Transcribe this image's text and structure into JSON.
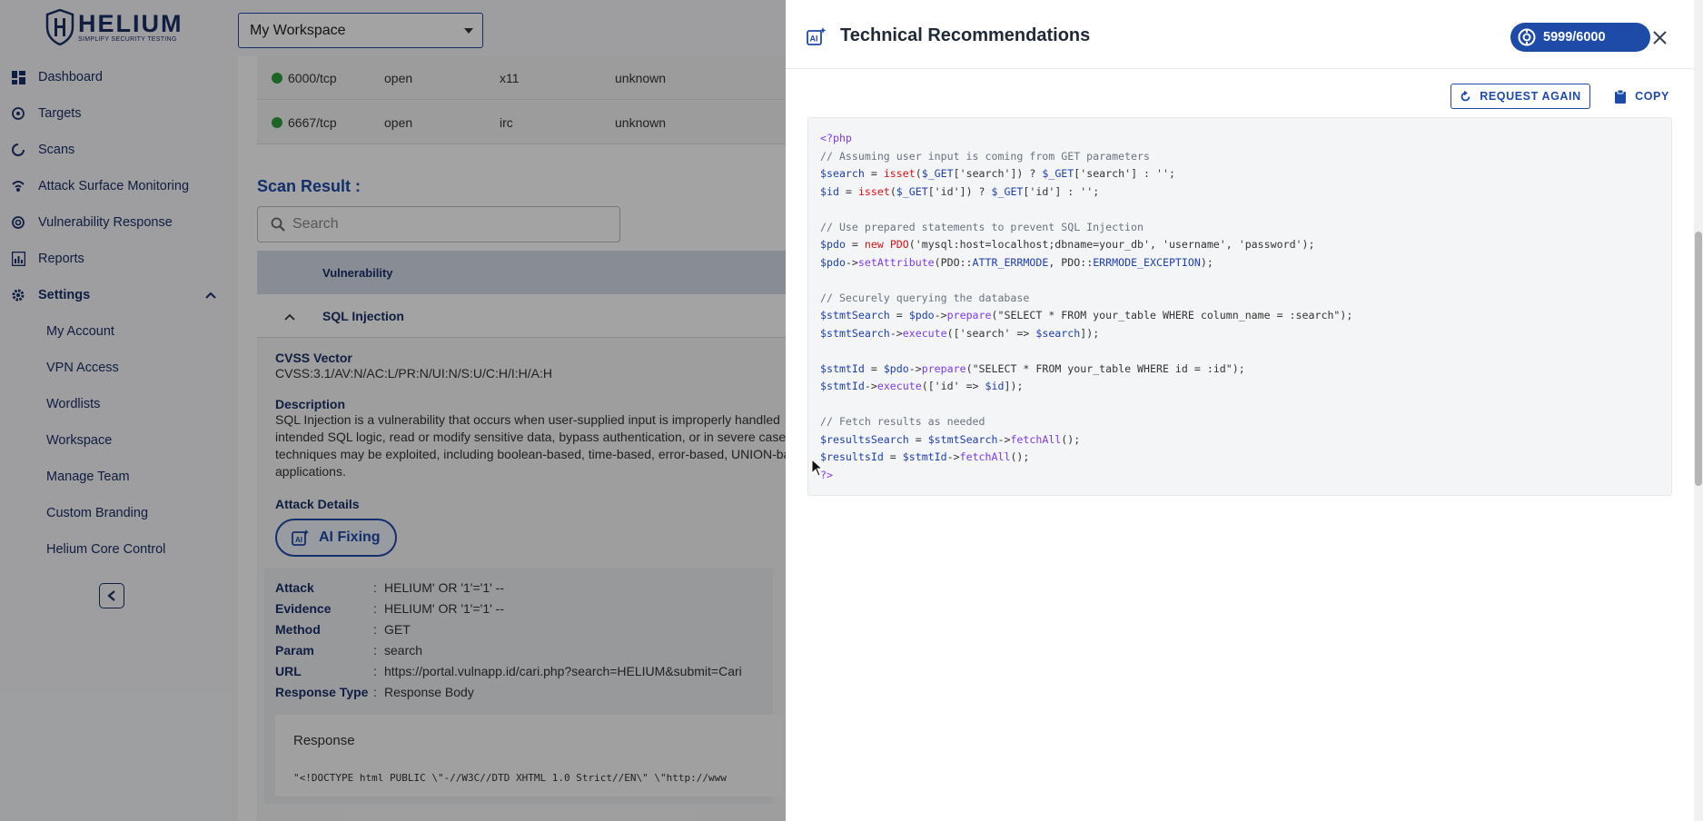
{
  "sidebar": {
    "logo": {
      "name": "HELIUM",
      "tagline": "SIMPLIFY SECURITY TESTING"
    },
    "items": [
      {
        "label": "Dashboard",
        "icon": "dashboard-icon"
      },
      {
        "label": "Targets",
        "icon": "target-icon"
      },
      {
        "label": "Scans",
        "icon": "scan-icon"
      },
      {
        "label": "Attack Surface Monitoring",
        "icon": "monitoring-icon"
      },
      {
        "label": "Vulnerability Response",
        "icon": "vulnerability-icon"
      },
      {
        "label": "Reports",
        "icon": "reports-icon"
      }
    ],
    "settings": {
      "label": "Settings",
      "expanded": true,
      "children": [
        "My Account",
        "VPN Access",
        "Wordlists",
        "Workspace",
        "Manage Team",
        "Custom Branding",
        "Helium Core Control"
      ]
    },
    "collapse_icon": "chevron-left-icon"
  },
  "topbar": {
    "workspace": "My Workspace"
  },
  "content": {
    "ports": [
      {
        "port": "6000/tcp",
        "state": "open",
        "service": "x11",
        "version": "unknown"
      },
      {
        "port": "6667/tcp",
        "state": "open",
        "service": "irc",
        "version": "unknown"
      }
    ],
    "scan_result_title": "Scan Result :",
    "search_placeholder": "Search",
    "table_header": "Vulnerability",
    "vuln_name": "SQL Injection",
    "cvss_label": "CVSS Vector",
    "cvss_value": "CVSS:3.1/AV:N/AC:L/PR:N/UI:N/S:U/C:H/I:H/A:H",
    "description_label": "Description",
    "description_lines": [
      "SQL Injection is a vulnerability that occurs when user-supplied input is improperly handled",
      "intended SQL logic, read or modify sensitive data, bypass authentication, or in severe case",
      "techniques may be exploited, including boolean-based, time-based, error-based, UNION-ba",
      "applications."
    ],
    "attack_details_label": "Attack Details",
    "ai_fixing_label": "AI Fixing",
    "attack_rows": [
      {
        "k": "Attack",
        "v": "HELIUM' OR '1'='1' --"
      },
      {
        "k": "Evidence",
        "v": "HELIUM' OR '1'='1' --"
      },
      {
        "k": "Method",
        "v": "GET"
      },
      {
        "k": "Param",
        "v": "search"
      },
      {
        "k": "URL",
        "v": "https://portal.vulnapp.id/cari.php?search=HELIUM&submit=Cari"
      },
      {
        "k": "Response Type",
        "v": "Response Body"
      }
    ],
    "response_label": "Response",
    "response_snippet": "\"<!DOCTYPE html PUBLIC \\\"-//W3C//DTD XHTML 1.0 Strict//EN\\\" \\\"http://www"
  },
  "drawer": {
    "title": "Technical Recommendations",
    "credits": "5999/6000",
    "request_again": "REQUEST AGAIN",
    "copy": "COPY",
    "code_lines": [
      "<?php",
      "// Assuming user input is coming from GET parameters",
      "$search = isset($_GET['search']) ? $_GET['search'] : '';",
      "$id = isset($_GET['id']) ? $_GET['id'] : '';",
      "",
      "// Use prepared statements to prevent SQL Injection",
      "$pdo = new PDO('mysql:host=localhost;dbname=your_db', 'username', 'password');",
      "$pdo->setAttribute(PDO::ATTR_ERRMODE, PDO::ERRMODE_EXCEPTION);",
      "",
      "// Securely querying the database",
      "$stmtSearch = $pdo->prepare(\"SELECT * FROM your_table WHERE column_name = :search\");",
      "$stmtSearch->execute(['search' => $search]);",
      "",
      "$stmtId = $pdo->prepare(\"SELECT * FROM your_table WHERE id = :id\");",
      "$stmtId->execute(['id' => $id]);",
      "",
      "// Fetch results as needed",
      "$resultsSearch = $stmtSearch->fetchAll();",
      "$resultsId = $stmtId->fetchAll();",
      "?>"
    ]
  },
  "colors": {
    "brand": "#1e4aa8",
    "navy": "#1a2f66",
    "status_open": "#2e9e3e"
  }
}
